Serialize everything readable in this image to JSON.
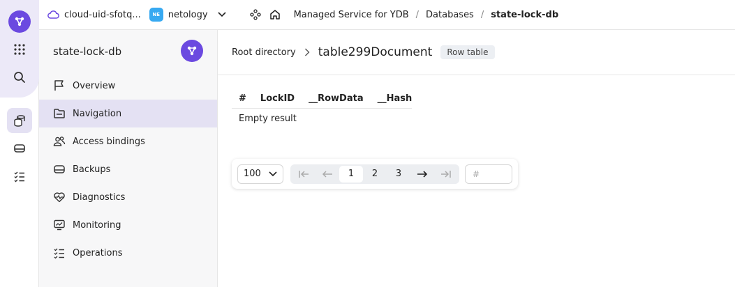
{
  "topbar": {
    "cloud_label": "cloud-uid-sfotq...",
    "folder_badge": "NE",
    "folder_label": "netology",
    "breadcrumb": [
      "Managed Service for YDB",
      "Databases",
      "state-lock-db"
    ],
    "separator": "/"
  },
  "sidebar": {
    "title": "state-lock-db",
    "items": [
      {
        "label": "Overview",
        "icon": "flag-icon"
      },
      {
        "label": "Navigation",
        "icon": "folder-icon",
        "active": true
      },
      {
        "label": "Access bindings",
        "icon": "users-icon"
      },
      {
        "label": "Backups",
        "icon": "storage-icon"
      },
      {
        "label": "Diagnostics",
        "icon": "heart-pulse-icon"
      },
      {
        "label": "Monitoring",
        "icon": "monitor-chart-icon"
      },
      {
        "label": "Operations",
        "icon": "list-check-icon"
      }
    ]
  },
  "main": {
    "root_label": "Root directory",
    "table_name": "table299Document",
    "table_type": "Row table",
    "columns": [
      "#",
      "LockID",
      "__RowData",
      "__Hash"
    ],
    "empty_text": "Empty result"
  },
  "pagination": {
    "page_size": "100",
    "pages": [
      "1",
      "2",
      "3"
    ],
    "current_page": "1",
    "page_input_placeholder": "#"
  },
  "colors": {
    "accent": "#6b49e0",
    "active_bg": "#e4e1f3",
    "folder_badge": "#37a9f1"
  }
}
